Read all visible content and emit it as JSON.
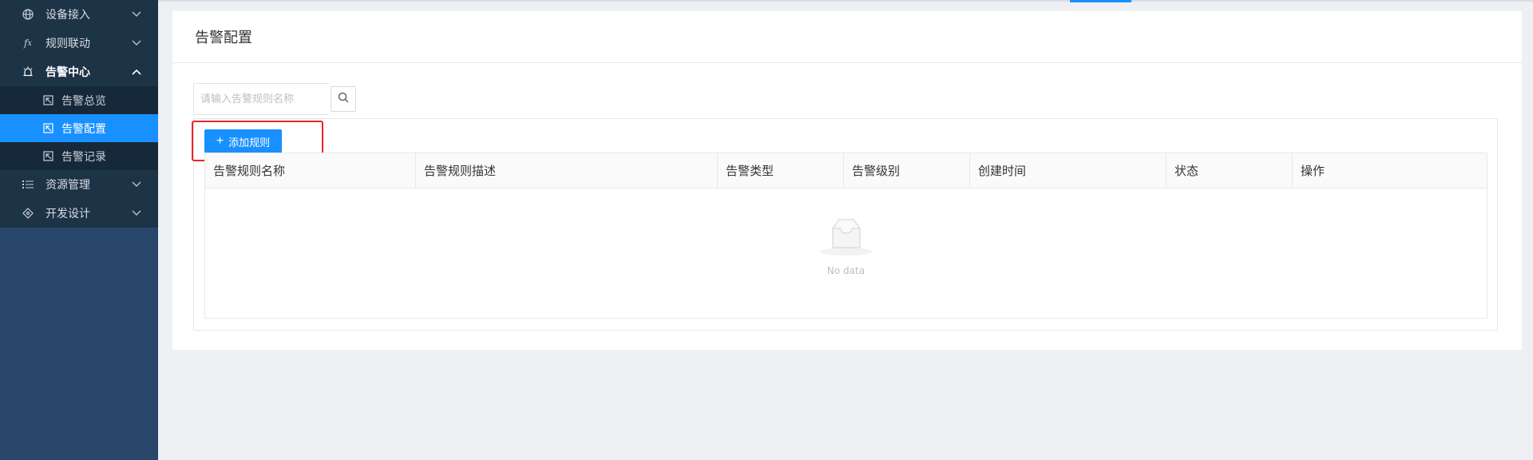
{
  "sidebar": {
    "items": [
      {
        "label": "设备接入",
        "icon": "globe-icon"
      },
      {
        "label": "规则联动",
        "icon": "function-icon"
      },
      {
        "label": "告警中心",
        "icon": "alarm-icon"
      },
      {
        "label": "资源管理",
        "icon": "list-icon"
      },
      {
        "label": "开发设计",
        "icon": "design-icon"
      }
    ],
    "sub_items": [
      {
        "label": "告警总览"
      },
      {
        "label": "告警配置"
      },
      {
        "label": "告警记录"
      }
    ]
  },
  "page": {
    "title": "告警配置"
  },
  "search": {
    "placeholder": "请输入告警规则名称"
  },
  "toolbar": {
    "add_label": "添加规则"
  },
  "table": {
    "columns": [
      "告警规则名称",
      "告警规则描述",
      "告警类型",
      "告警级别",
      "创建时间",
      "状态",
      "操作"
    ],
    "empty_text": "No data"
  },
  "colors": {
    "accent": "#1890ff",
    "sidebar_bg": "#28476a",
    "highlight": "#e8262b"
  }
}
